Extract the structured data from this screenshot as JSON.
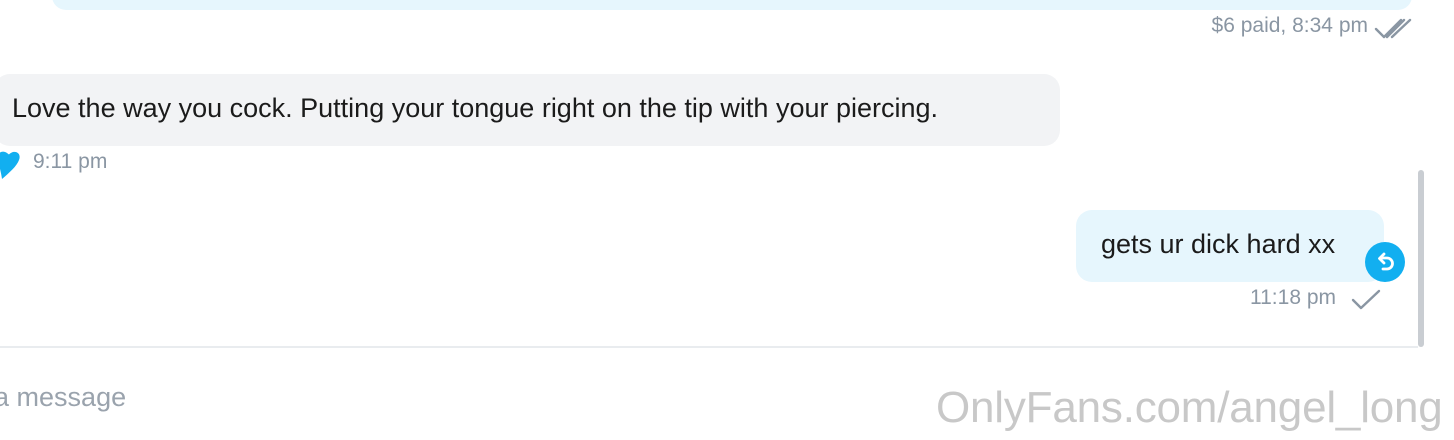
{
  "messages": [
    {
      "direction": "outgoing",
      "status": "$6 paid,",
      "time": "8:34 pm",
      "read_icon": "double-check-icon"
    },
    {
      "direction": "incoming",
      "text": "Love the way you cock. Putting your tongue right on the tip with your piercing.",
      "time": "9:11 pm",
      "reaction_icon": "heart-icon",
      "reaction_color": "#12aff0"
    },
    {
      "direction": "outgoing",
      "text": "gets ur dick hard xx",
      "time": "11:18 pm",
      "read_icon": "check-icon",
      "action_icon": "undo-icon"
    }
  ],
  "composer": {
    "placeholder": "Type a message"
  },
  "watermark": {
    "text": "OnlyFans.com/angel_long"
  },
  "colors": {
    "accent": "#12aff0",
    "outgoing_bubble": "#e6f6fd",
    "incoming_bubble": "#f2f3f5",
    "meta_text": "#8a96a3"
  }
}
